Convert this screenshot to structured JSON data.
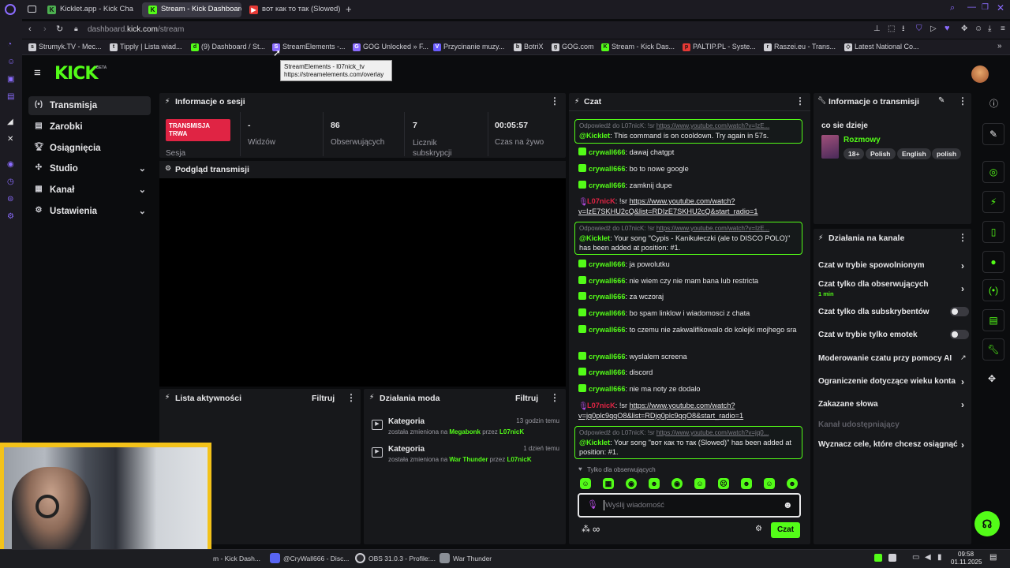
{
  "browser": {
    "tabs": [
      {
        "label": "Kicklet.app - Kick Cha",
        "color": "#4caf50"
      },
      {
        "label": "Stream - Kick Dashboard",
        "color": "#53fc18"
      },
      {
        "label": "вот как то так (Slowed) -",
        "color": "#e53935"
      }
    ],
    "url_prefix": "dashboard.",
    "url_host": "kick.com",
    "url_path": "/stream",
    "bookmarks": [
      "Strumyk.TV - Mec...",
      "Tipply | Lista wiad...",
      "(9) Dashboard / St...",
      "StreamElements -...",
      "GOG Unlocked » F...",
      "Przycinanie muzy...",
      "BotriX",
      "GOG.com",
      "Stream - Kick Das...",
      "PALTIP.PL - Syste...",
      "Raszei.eu - Trans...",
      "Latest National Co..."
    ],
    "tooltip": {
      "line1": "StreamElements - l07nick_tv",
      "line2": "https://streamelements.com/overlay"
    }
  },
  "kick": {
    "logo": "KICK",
    "logo_badge": "BETA",
    "sidebar": [
      {
        "label": "Transmisja"
      },
      {
        "label": "Zarobki"
      },
      {
        "label": "Osiągnięcia"
      },
      {
        "label": "Studio"
      },
      {
        "label": "Kanał"
      },
      {
        "label": "Ustawienia"
      }
    ],
    "session": {
      "title": "Informacje o sesji",
      "live_badge": "TRANSMISJA TRWA",
      "live_label": "Sesja",
      "stats": [
        {
          "value": "-",
          "label": "Widzów"
        },
        {
          "value": "86",
          "label": "Obserwujących"
        },
        {
          "value": "7",
          "label": "Licznik subskrypcji"
        },
        {
          "value": "00:05:57",
          "label": "Czas na żywo"
        }
      ]
    },
    "preview_title": "Podgląd transmisji",
    "activity": {
      "title": "Lista aktywności",
      "filter": "Filtruj"
    },
    "mod": {
      "title": "Działania moda",
      "filter": "Filtruj",
      "items": [
        {
          "title": "Kategoria",
          "time": "13 godzin temu",
          "pre": "została zmieniona na",
          "target": "Megabonk",
          "by": "przez",
          "user": "L07nicK"
        },
        {
          "title": "Kategoria",
          "time": "1 dzień temu",
          "pre": "została zmieniona na",
          "target": "War Thunder",
          "by": "przez",
          "user": "L07nicK"
        }
      ]
    },
    "chat": {
      "title": "Czat",
      "reply_label": "Odpowiedź do L07nicK: !sr",
      "reply_url": "https://www.youtube.com/watch?v=IzE...",
      "reply_url2": "https://www.youtube.com/watch?v=jq0...",
      "bot": "@Kicklet",
      "r1": "This command is on cooldown. Try again in 57s.",
      "m1u": "crywall666",
      "m1": "dawaj chatgpt",
      "m2u": "crywall666",
      "m2": "bo to nowe google",
      "m3u": "crywall666",
      "m3": "zamknij dupe",
      "l1u": "L07nicK",
      "l1p": "!sr",
      "l1a": "https://www.youtube.com/watch?",
      "l1b": "v=IzE7SKHU2cQ&list=RDIzE7SKHU2cQ&start_radio=1",
      "r2": "Your song \"Cypis - Kanikułeczki (ale to DISCO POLO)\" has been added at position: #1.",
      "m4u": "crywall666",
      "m4": "ja powolutku",
      "m5u": "crywall666",
      "m5": "nie wiem czy nie mam bana lub restricta",
      "m6u": "crywall666",
      "m6": "za wczoraj",
      "m7u": "crywall666",
      "m7": "bo spam linklow i wiadomosci z chata",
      "m8u": "crywall666",
      "m8": "to czemu nie zakwalifikowalo do kolejki mojhego sra",
      "m9u": "crywall666",
      "m9": "wyslalem screena",
      "m10u": "crywall666",
      "m10": "discord",
      "m11u": "crywall666",
      "m11": "nie ma noty ze dodalo",
      "l2u": "L07nicK",
      "l2p": "!sr",
      "l2a": "https://www.youtube.com/watch?",
      "l2b": "v=jq0plc9qqO8&list=RDjq0plc9qqO8&start_radio=1",
      "r3": "Your song \"вот как то так (Slowed)\" has been added at position: #1.",
      "followers_only": "Tylko dla obserwujących",
      "input_placeholder": "Wyślij wiadomość",
      "send": "Czat"
    },
    "stream_info": {
      "title": "Informacje o transmisji",
      "stream_title": "co sie dzieje",
      "category": "Rozmowy",
      "tags": [
        "18+",
        "Polish",
        "English",
        "polish"
      ]
    },
    "channel_actions": {
      "title": "Działania na kanale",
      "slow": "Czat w trybie spowolnionym",
      "followers": "Czat tylko dla obserwujących",
      "followers_sub": "1 min",
      "subs": "Czat tylko dla subskrybentów",
      "emotes": "Czat w trybie tylko emotek",
      "ai_mod": "Moderowanie czatu przy pomocy AI",
      "age": "Ograniczenie dotyczące wieku konta",
      "banned": "Zakazane słowa",
      "shared": "Kanał udostępniający",
      "goals": "Wyznacz cele, które chcesz osiągnąć"
    }
  },
  "taskbar": {
    "items": [
      "m - Kick Dash...",
      "@CryWall666 - Disc...",
      "OBS 31.0.3 - Profile:...",
      "War Thunder"
    ],
    "time": "09:58",
    "date": "01.11.2025"
  },
  "colors": {
    "accent": "#53fc18",
    "live": "#e02444",
    "bg": "#0b0c0e",
    "panel": "#17181b"
  }
}
